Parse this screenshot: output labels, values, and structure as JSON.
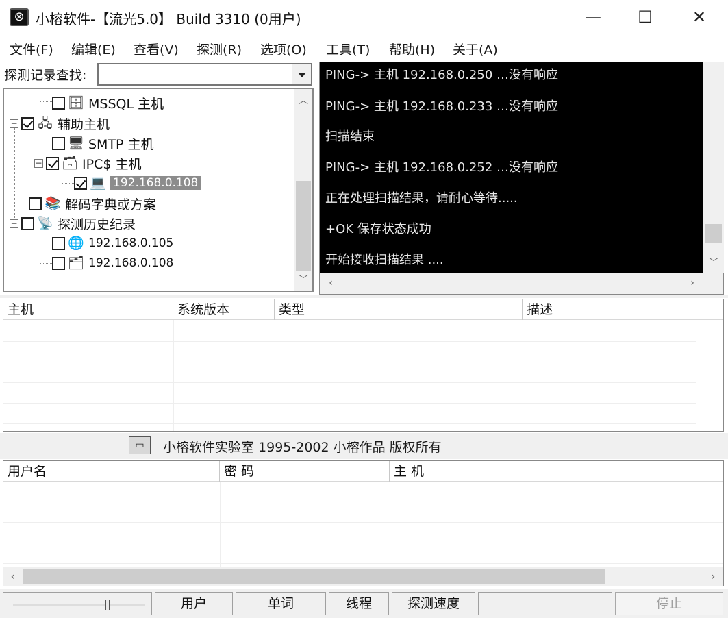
{
  "window": {
    "title": "小榕软件-【流光5.0】 Build 3310 (0用户)",
    "minimize_glyph": "—",
    "maximize_glyph": "☐",
    "close_glyph": "✕",
    "icon": "app-logo-icon"
  },
  "menu": {
    "items": [
      "文件(F)",
      "编辑(E)",
      "查看(V)",
      "探测(R)",
      "选项(O)",
      "工具(T)",
      "帮助(H)",
      "关于(A)"
    ]
  },
  "search": {
    "label": "探测记录查找:",
    "value": ""
  },
  "tree": {
    "items": [
      {
        "label": "MSSQL 主机",
        "checked": false,
        "icon": "database-server-icon"
      },
      {
        "label": "辅助主机",
        "checked": true,
        "icon": "server-group-icon"
      },
      {
        "label": "SMTP 主机",
        "checked": false,
        "icon": "mail-server-icon"
      },
      {
        "label": "IPC$ 主机",
        "checked": true,
        "icon": "ipc-server-icon"
      },
      {
        "label": "192.168.0.108",
        "checked": true,
        "icon": "computer-icon",
        "selected": true
      },
      {
        "label": "解码字典或方案",
        "checked": false,
        "icon": "dictionary-book-icon"
      },
      {
        "label": "探测历史纪录",
        "checked": false,
        "icon": "history-satellite-icon"
      },
      {
        "label": "192.168.0.105",
        "checked": false,
        "icon": "globe-icon"
      },
      {
        "label": "192.168.0.108",
        "checked": false,
        "icon": "host-record-icon"
      }
    ]
  },
  "console": {
    "lines": [
      "PING-> 主机 192.168.0.250 …没有响应",
      "PING-> 主机 192.168.0.233 …没有响应",
      "扫描结束",
      "PING-> 主机 192.168.0.252 …没有响应",
      "正在处理扫描结果，请耐心等待.....",
      "+OK 保存状态成功",
      "开始接收扫描结果 ...."
    ]
  },
  "host_table": {
    "columns": [
      "主机",
      "系统版本",
      "类型",
      "描述"
    ]
  },
  "copyright": {
    "text": "小榕软件实验室 1995-2002 小榕作品 版权所有"
  },
  "cred_table": {
    "columns": [
      "用户名",
      "密 码",
      "主 机"
    ]
  },
  "statusbar": {
    "slider_fraction": 0.72,
    "panes": [
      "用户",
      "单词",
      "线程",
      "探测速度"
    ],
    "stop_label": "停止"
  }
}
